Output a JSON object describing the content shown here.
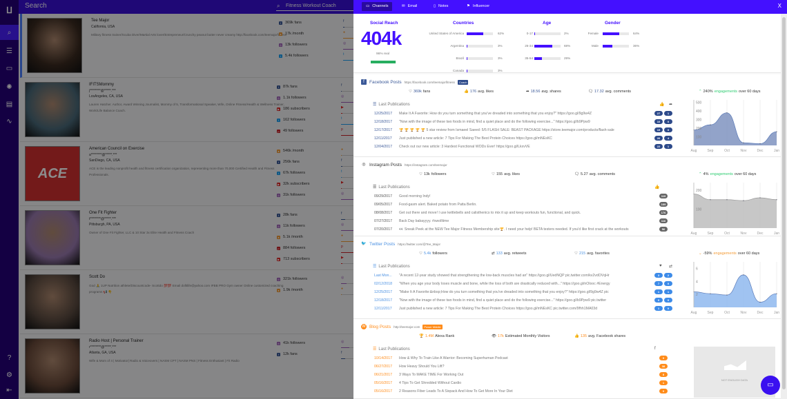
{
  "search": {
    "title": "Search",
    "query": "Fitness Workout Coach"
  },
  "sidebar": {
    "items": [
      "search-icon",
      "list-icon",
      "inbox-icon",
      "settings-sun-icon",
      "stack-icon",
      "activity-icon",
      "help-icon",
      "gear-icon",
      "logout-icon"
    ]
  },
  "influencers": [
    {
      "name": "Tee Major",
      "email": "",
      "location": "California, USA",
      "bio": "Military fitness trainer/Scuba Diver/Martial Arts lover/Entrepreneur/Crunchy peanut butter never creamy http://facebook.com/teemajorfitness",
      "picture": "#3a2a20",
      "stats": [
        {
          "icon": "facebook",
          "text": "369k fans"
        },
        {
          "icon": "blog",
          "text": "17k /month"
        },
        {
          "icon": "instagram",
          "text": "13k followers"
        },
        {
          "icon": "twitter",
          "text": "5.4k followers"
        }
      ],
      "bars": [
        {
          "icon": "facebook",
          "fill": 0.1
        },
        {
          "icon": "blog",
          "fill": 1
        },
        {
          "icon": "instagram",
          "fill": 1
        },
        {
          "icon": "twitter",
          "fill": 1
        }
      ]
    },
    {
      "name": "IFITSMommy",
      "email": "j********@*****.***",
      "location": "LosAngeles, CA, USA",
      "bio": "Lauren Hatcher. Author, Award Winning Journalist, Mommy of 5, Transformational Speaker, Wife, Online Fitness/Health & Wellness Trainer, Work/Life Balance Coach.",
      "picture": "#4a6a7a",
      "stats": [
        {
          "icon": "facebook",
          "text": "87k fans"
        },
        {
          "icon": "instagram",
          "text": "1.1k followers"
        },
        {
          "icon": "youtube",
          "text": "186 subscribers"
        },
        {
          "icon": "twitter",
          "text": "162 followers"
        },
        {
          "icon": "pinterest",
          "text": "49 followers"
        }
      ],
      "bars": [
        {
          "icon": "facebook",
          "fill": 0.05
        },
        {
          "icon": "instagram",
          "fill": 1
        },
        {
          "icon": "youtube",
          "fill": 0.1
        },
        {
          "icon": "twitter",
          "fill": 1
        },
        {
          "icon": "pinterest",
          "fill": 1
        }
      ]
    },
    {
      "name": "American Council on Exercise",
      "email": "a********@*****.***",
      "location": "SanDiego, CA, USA",
      "bio": "ACE is the leading nonprofit health and fitness certification organization, representing more than 70,000 Certified Health and Fitness Professionals.",
      "picture": "#d23030",
      "logo": "ACE",
      "stats": [
        {
          "icon": "blog",
          "text": "546k /month"
        },
        {
          "icon": "facebook",
          "text": "256k fans"
        },
        {
          "icon": "twitter",
          "text": "67k followers"
        },
        {
          "icon": "youtube",
          "text": "32k subscribers"
        },
        {
          "icon": "instagram",
          "text": "31k followers"
        }
      ],
      "bars": [
        {
          "icon": "blog",
          "fill": 0.05
        },
        {
          "icon": "facebook",
          "fill": 0.1
        },
        {
          "icon": "twitter",
          "fill": 0.05
        },
        {
          "icon": "youtube",
          "fill": 0.05
        },
        {
          "icon": "instagram",
          "fill": 1
        }
      ]
    },
    {
      "name": "One Fit Fighter",
      "email": "t********@*****.***",
      "location": "Pittsburgh, PA, USA",
      "bio": "Owner of One Fit Fighter, LLC & 10 Star 3x Elite Health and Fitness Coach",
      "picture": "#9a7ab0",
      "stats": [
        {
          "icon": "facebook",
          "text": "28k fans"
        },
        {
          "icon": "instagram",
          "text": "11k followers"
        },
        {
          "icon": "blog",
          "text": "5.1k /month"
        },
        {
          "icon": "pinterest",
          "text": "884 followers"
        },
        {
          "icon": "youtube",
          "text": "713 subscribers"
        }
      ],
      "bars": [
        {
          "icon": "facebook",
          "fill": 0.3
        },
        {
          "icon": "instagram",
          "fill": 0.9
        },
        {
          "icon": "blog",
          "fill": 1
        },
        {
          "icon": "pinterest",
          "fill": 1
        },
        {
          "icon": "youtube",
          "fill": 0.1
        }
      ]
    },
    {
      "name": "Scott Do",
      "email": "",
      "location": "",
      "bio": "God 🙏 1UP Nutrition athlete/Discountcode- Scottdo 💯💯 Email dofitlife@yahoo.com IFBB PRO Gym owner Online customized coaching programs 📢 👇",
      "picture": "#5a4a40",
      "stats": [
        {
          "icon": "instagram",
          "text": "321k followers"
        },
        {
          "icon": "blog",
          "text": "1.9k /month"
        }
      ],
      "bars": [
        {
          "icon": "instagram",
          "fill": 0.4
        },
        {
          "icon": "blog",
          "fill": 0.05
        }
      ]
    },
    {
      "name": "Radio Host | Personal Trainer",
      "email": "r********@*****.***",
      "location": "Atlanta, GA, USA",
      "bio": "Wife & Mom of 4 | Motivator| Radio & Voiceovers | NASM CPT | NASM PNS | Fitness Enthusiast | Fit Radio",
      "picture": "#6a4a3a",
      "stats": [
        {
          "icon": "instagram",
          "text": "41k followers"
        },
        {
          "icon": "facebook",
          "text": "12k fans"
        }
      ],
      "bars": [
        {
          "icon": "instagram",
          "fill": 0.6
        },
        {
          "icon": "facebook",
          "fill": 0.3
        }
      ]
    }
  ],
  "panel": {
    "tabs": [
      {
        "label": "Channels",
        "icon": "monitor-icon"
      },
      {
        "label": "Email",
        "icon": "envelope-icon"
      },
      {
        "label": "Notes",
        "icon": "note-icon"
      },
      {
        "label": "Influencer",
        "icon": "flag-icon"
      }
    ],
    "close": "X",
    "summary": {
      "reach_title": "Social Reach",
      "reach": "404k",
      "real": "96% real",
      "real_fill": 0.96,
      "countries_title": "Countries",
      "countries": [
        {
          "label": "United States of America",
          "pct": "62%",
          "v": 0.62
        },
        {
          "label": "Argentina",
          "pct": "3%",
          "v": 0.03
        },
        {
          "label": "Brazil",
          "pct": "3%",
          "v": 0.03
        },
        {
          "label": "Canada",
          "pct": "3%",
          "v": 0.03
        }
      ],
      "age_title": "Age",
      "age": [
        {
          "label": "0-17",
          "pct": "2%",
          "v": 0.02
        },
        {
          "label": "25-34",
          "pct": "68%",
          "v": 0.68
        },
        {
          "label": "35-54",
          "pct": "29%",
          "v": 0.29
        }
      ],
      "gender_title": "Gender",
      "gender": [
        {
          "label": "Female",
          "pct": "64%",
          "v": 0.64
        },
        {
          "label": "Male",
          "pct": "36%",
          "v": 0.36
        }
      ]
    },
    "sections": [
      {
        "key": "facebook",
        "title": "Facebook Posts",
        "url": "https://facebook.com/teemajorfitness",
        "tag": "Coach",
        "color": "#3b5998",
        "badge": "#2d4a8a",
        "stats": [
          {
            "icon": "♡",
            "value": "369k",
            "label": "fans"
          },
          {
            "icon": "👍",
            "value": "176",
            "label": "avg. likes"
          },
          {
            "icon": "➦",
            "value": "18.56",
            "label": "avg. shares"
          },
          {
            "icon": "🗨",
            "value": "17.32",
            "label": "avg. comments"
          }
        ],
        "last": "Last Publications",
        "cols": [
          "👍",
          "➦"
        ],
        "posts": [
          {
            "date": "12/25/2017",
            "text": "Make It A Favorite: How do you turn something that you've dreaded into something that you enjoy?\" https://goo.gl/9g9w4Z",
            "b": [
              "27",
              "1"
            ]
          },
          {
            "date": "12/18/2017",
            "text": "\"Now with the image of these two foods in mind, find a quiet place and do the following exercise...\" https://goo.gl/b9Ppw9",
            "b": [
              "10",
              "0"
            ]
          },
          {
            "date": "12/17/2017",
            "text": "🏆 🏆 🏆 🏆 🏆 5 star review from Ismaeel Saeed: 5/5 FLASH SALE: BEAST PACKAGE https://store.teemajor.com/products/flash-sale",
            "b": [
              "19",
              "0"
            ]
          },
          {
            "date": "12/11/2017",
            "text": "Just published a new article: 7 Tips For Making The Best Protein Choices https://goo.gl/mNEsKC",
            "b": [
              "26",
              "4"
            ]
          },
          {
            "date": "12/04/2017",
            "text": "Check out our new article: 3 Hardest Functional WODs Ever! https://goo.gl/LkxvVE",
            "b": [
              "22",
              "1"
            ]
          }
        ],
        "eng": {
          "arrow": "^",
          "value": "240%",
          "word": "engagements",
          "rest": "over 60 days",
          "color": "#2ecc71"
        }
      },
      {
        "key": "instagram",
        "title": "Instagram Posts",
        "url": "https://instagram.com/teemajor",
        "color": "#333",
        "badge": "#666",
        "stats": [
          {
            "icon": "♡",
            "value": "13k",
            "label": "followers"
          },
          {
            "icon": "♡",
            "value": "155",
            "label": "avg. likes"
          },
          {
            "icon": "🗨",
            "value": "5.27",
            "label": "avg. comments"
          }
        ],
        "last": "Last Publications",
        "cols": [
          "👍"
        ],
        "posts": [
          {
            "date": "09/29/2017",
            "text": "Good morning Indy!",
            "b": [
              "119"
            ]
          },
          {
            "date": "09/05/2017",
            "text": "Food-gasm alert. Baked potato from Patta Berlin.",
            "b": [
              "169"
            ]
          },
          {
            "date": "08/08/2017",
            "text": "Get out there and move! I use kettlebells and calisthenics to mix it up and keep workouts fun, functional, and quick.",
            "b": [
              "176"
            ]
          },
          {
            "date": "07/27/2017",
            "text": "Back Day babayyyy. #swolltime",
            "b": [
              "116"
            ]
          },
          {
            "date": "07/20/2017",
            "text": "👀 Sneak Peek at the NEW Tee Major Fitness Membership site🏆. I need your help! BETA testers needed. If you'd like first crack at the workouts",
            "b": [
              "56"
            ]
          }
        ],
        "eng": {
          "arrow": "^",
          "value": "4%",
          "word": "engagements",
          "rest": "over 60 days",
          "color": "#2ecc71"
        }
      },
      {
        "key": "twitter",
        "title": "Twitter Posts",
        "url": "https://twitter.com/@Tee_Major",
        "color": "#4a90e2",
        "badge": "#3d8be8",
        "stats": [
          {
            "icon": "♡",
            "value": "5.4k",
            "label": "followers"
          },
          {
            "icon": "⇄",
            "value": "133",
            "label": "avg. retweets"
          },
          {
            "icon": "♡",
            "value": "215",
            "label": "avg. favorites"
          }
        ],
        "last": "Last Publications",
        "cols": [
          "♥",
          "⇄"
        ],
        "posts": [
          {
            "date": "Last Mon...",
            "text": "\"A recent 12-year study showed that strengthening the low-back muscles had an\" https://goo.gl/UedNQP pic.twitter.com/kv2vdOVqHr",
            "b": [
              "3",
              "2"
            ]
          },
          {
            "date": "02/12/2018",
            "text": "\"When you age your body loses muscle and bone, while the loss of both are drastically reduced with...\" https://goo.gl/nOlooc #Energy",
            "b": [
              "7",
              "0"
            ]
          },
          {
            "date": "12/25/2017",
            "text": "\"Make It A Favorite:&nbsp;How do you turn something that you've dreaded into something that you enjoy?\" https://goo.gl/9g9w4Z pic",
            "b": [
              "1",
              "1"
            ]
          },
          {
            "date": "12/18/2017",
            "text": "\"Now with the image of these two foods in mind, find a quiet place and do the following exercise...\" https://goo.gl/b9Ppw9 pic.twitter",
            "b": [
              "0",
              "0"
            ]
          },
          {
            "date": "12/11/2017",
            "text": "Just published a new article: 7 Tips For Making The Best Protein Choices https://goo.gl/mNEsKC pic.twitter.com/9fhh1MA03d",
            "b": [
              "1",
              "0"
            ]
          }
        ],
        "eng": {
          "arrow": "v",
          "value": "-59%",
          "word": "engagements",
          "rest": "over 60 days",
          "color": "#f39c38"
        }
      },
      {
        "key": "blog",
        "title": "Blog Posts",
        "url": "http://teemajor.com",
        "tag": "Power Middle",
        "color": "#ff8c1a",
        "badge": "#ff8c1a",
        "stats": [
          {
            "icon": "🏆",
            "value": "1.4M",
            "label": "Alexa Rank"
          },
          {
            "icon": "👁",
            "value": "17k",
            "label": "Estimated Monthly Visitors"
          },
          {
            "icon": "👍",
            "value": "135",
            "label": "avg. Facebook shares"
          }
        ],
        "last": "Last Publications",
        "cols": [
          "f"
        ],
        "posts": [
          {
            "date": "10/14/2017",
            "text": "How & Why To Train Like A Warrior: Becoming Superhuman Podcast",
            "b": [
              "0"
            ]
          },
          {
            "date": "06/27/2017",
            "text": "How Heavy Should You Lift?",
            "b": [
              "38"
            ]
          },
          {
            "date": "06/21/2017",
            "text": "3 Ways To MAKE TIME For Working Out",
            "b": [
              "8"
            ]
          },
          {
            "date": "05/16/2017",
            "text": "4 Tips To Get Shredded Without Cardio",
            "b": [
              "1"
            ]
          },
          {
            "date": "05/16/2017",
            "text": "2 Reasons Fiber Leads To A Sixpack And How To Get More In Your Diet",
            "b": [
              "0"
            ]
          }
        ],
        "nodata": "NOT ENOUGH DATA"
      }
    ]
  },
  "chart_data": [
    {
      "type": "area",
      "title": "Facebook engagements",
      "x": [
        "Aug",
        "Sep",
        "Oct",
        "Nov",
        "Dec",
        "Jan"
      ],
      "values": [
        180,
        240,
        380,
        30,
        20,
        160
      ],
      "yticks": [
        "100",
        "200",
        "300",
        "400",
        "500"
      ],
      "ylim": [
        0,
        530
      ],
      "color": "#7f93c0"
    },
    {
      "type": "area",
      "title": "Instagram engagements",
      "x": [
        "Aug",
        "Sep",
        "Oct",
        "Nov",
        "Dec",
        "Jan"
      ],
      "values": [
        180,
        150,
        150,
        145,
        160,
        150
      ],
      "yticks": [
        "100",
        "200"
      ],
      "ylim": [
        0,
        240
      ],
      "color": "#bdbdbd"
    },
    {
      "type": "area",
      "title": "Twitter engagements",
      "x": [
        "Aug",
        "Sep",
        "Oct",
        "Nov",
        "Dec",
        "Jan"
      ],
      "values": [
        2.4,
        2.1,
        1.9,
        5,
        0.8,
        2.1
      ],
      "yticks": [
        "2",
        "4",
        "6"
      ],
      "ylim": [
        0,
        7
      ],
      "color": "#8fb8ef"
    }
  ]
}
